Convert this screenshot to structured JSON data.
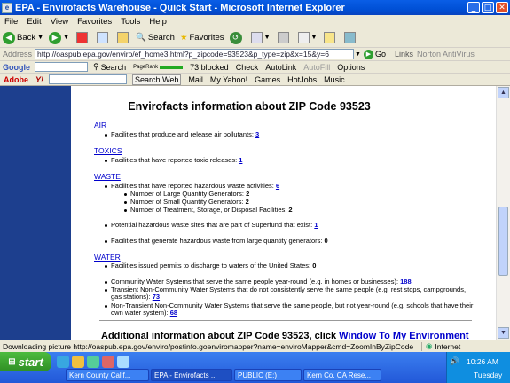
{
  "window": {
    "title": "EPA - Envirofacts Warehouse - Quick Start - Microsoft Internet Explorer"
  },
  "menu": [
    "File",
    "Edit",
    "View",
    "Favorites",
    "Tools",
    "Help"
  ],
  "toolbar": {
    "back": "Back",
    "search": "Search",
    "favorites": "Favorites"
  },
  "address": {
    "label": "Address",
    "url": "http://oaspub.epa.gov/enviro/ef_home3.html?p_zipcode=93523&p_type=zip&x=15&y=6",
    "go": "Go",
    "links": "Links",
    "norton": "Norton AntiVirus"
  },
  "google": {
    "label": "Google",
    "search": "Search",
    "pagerank": "PageRank",
    "blocked": "73 blocked",
    "check": "Check",
    "autolink": "AutoLink",
    "autofill": "AutoFill",
    "options": "Options"
  },
  "yahoo": {
    "adobe": "Adobe",
    "search_web": "Search Web",
    "mail": "Mail",
    "my_yahoo": "My Yahoo!",
    "games": "Games",
    "hotjobs": "HotJobs",
    "music": "Music"
  },
  "page": {
    "heading": "Envirofacts information about ZIP Code 93523",
    "air": {
      "label": "AIR",
      "line": "Facilities that produce and release air pollutants: ",
      "count": "3"
    },
    "toxics": {
      "label": "TOXICS",
      "line": "Facilities that have reported toxic releases: ",
      "count": "1"
    },
    "waste": {
      "label": "WASTE",
      "line": "Facilities that have reported hazardous waste activities: ",
      "count": "6",
      "sub1": "Number of Large Quantity Generators: ",
      "sub1_v": "2",
      "sub2": "Number of Small Quantity Generators: ",
      "sub2_v": "2",
      "sub3": "Number of Treatment, Storage, or Disposal Facilities: ",
      "sub3_v": "2",
      "superfund": "Potential hazardous waste sites that are part of Superfund that exist: ",
      "superfund_v": "1",
      "large": "Facilities that generate hazardous waste from large quantity generators: ",
      "large_v": "0"
    },
    "water": {
      "label": "WATER",
      "line": "Facilities issued permits to discharge to waters of the United States: ",
      "count": "0",
      "cws": "Community Water Systems that serve the same people year-round (e.g. in homes or businesses): ",
      "cws_v": "188",
      "tncws1": "Transient Non-Community Water Systems that do not consistently serve the same people (e.g. rest stops, campgrounds,",
      "tncws2": "gas stations): ",
      "tncws_v": "73",
      "ntncws1": "Non-Transient Non-Community Water Systems that serve the same people, but not year-round (e.g. schools that have their",
      "ntncws2": "own water system): ",
      "ntncws_v": "68"
    },
    "additional": "Additional information about ZIP Code 93523, click ",
    "additional_link": "Window To My Environment"
  },
  "status": {
    "message": "Downloading picture http://oaspub.epa.gov/enviro/postinfo.goenviromapper?name=enviroMapper&cmd=ZoomInByZipCode",
    "zone": "Internet"
  },
  "taskbar": {
    "start": "start",
    "buttons": [
      "Kern County Calif...",
      "EPA - Envirofacts ...",
      "PUBLIC (E:)",
      "Kern Co. CA Rese..."
    ],
    "time": "10:26 AM",
    "day": "Tuesday"
  }
}
